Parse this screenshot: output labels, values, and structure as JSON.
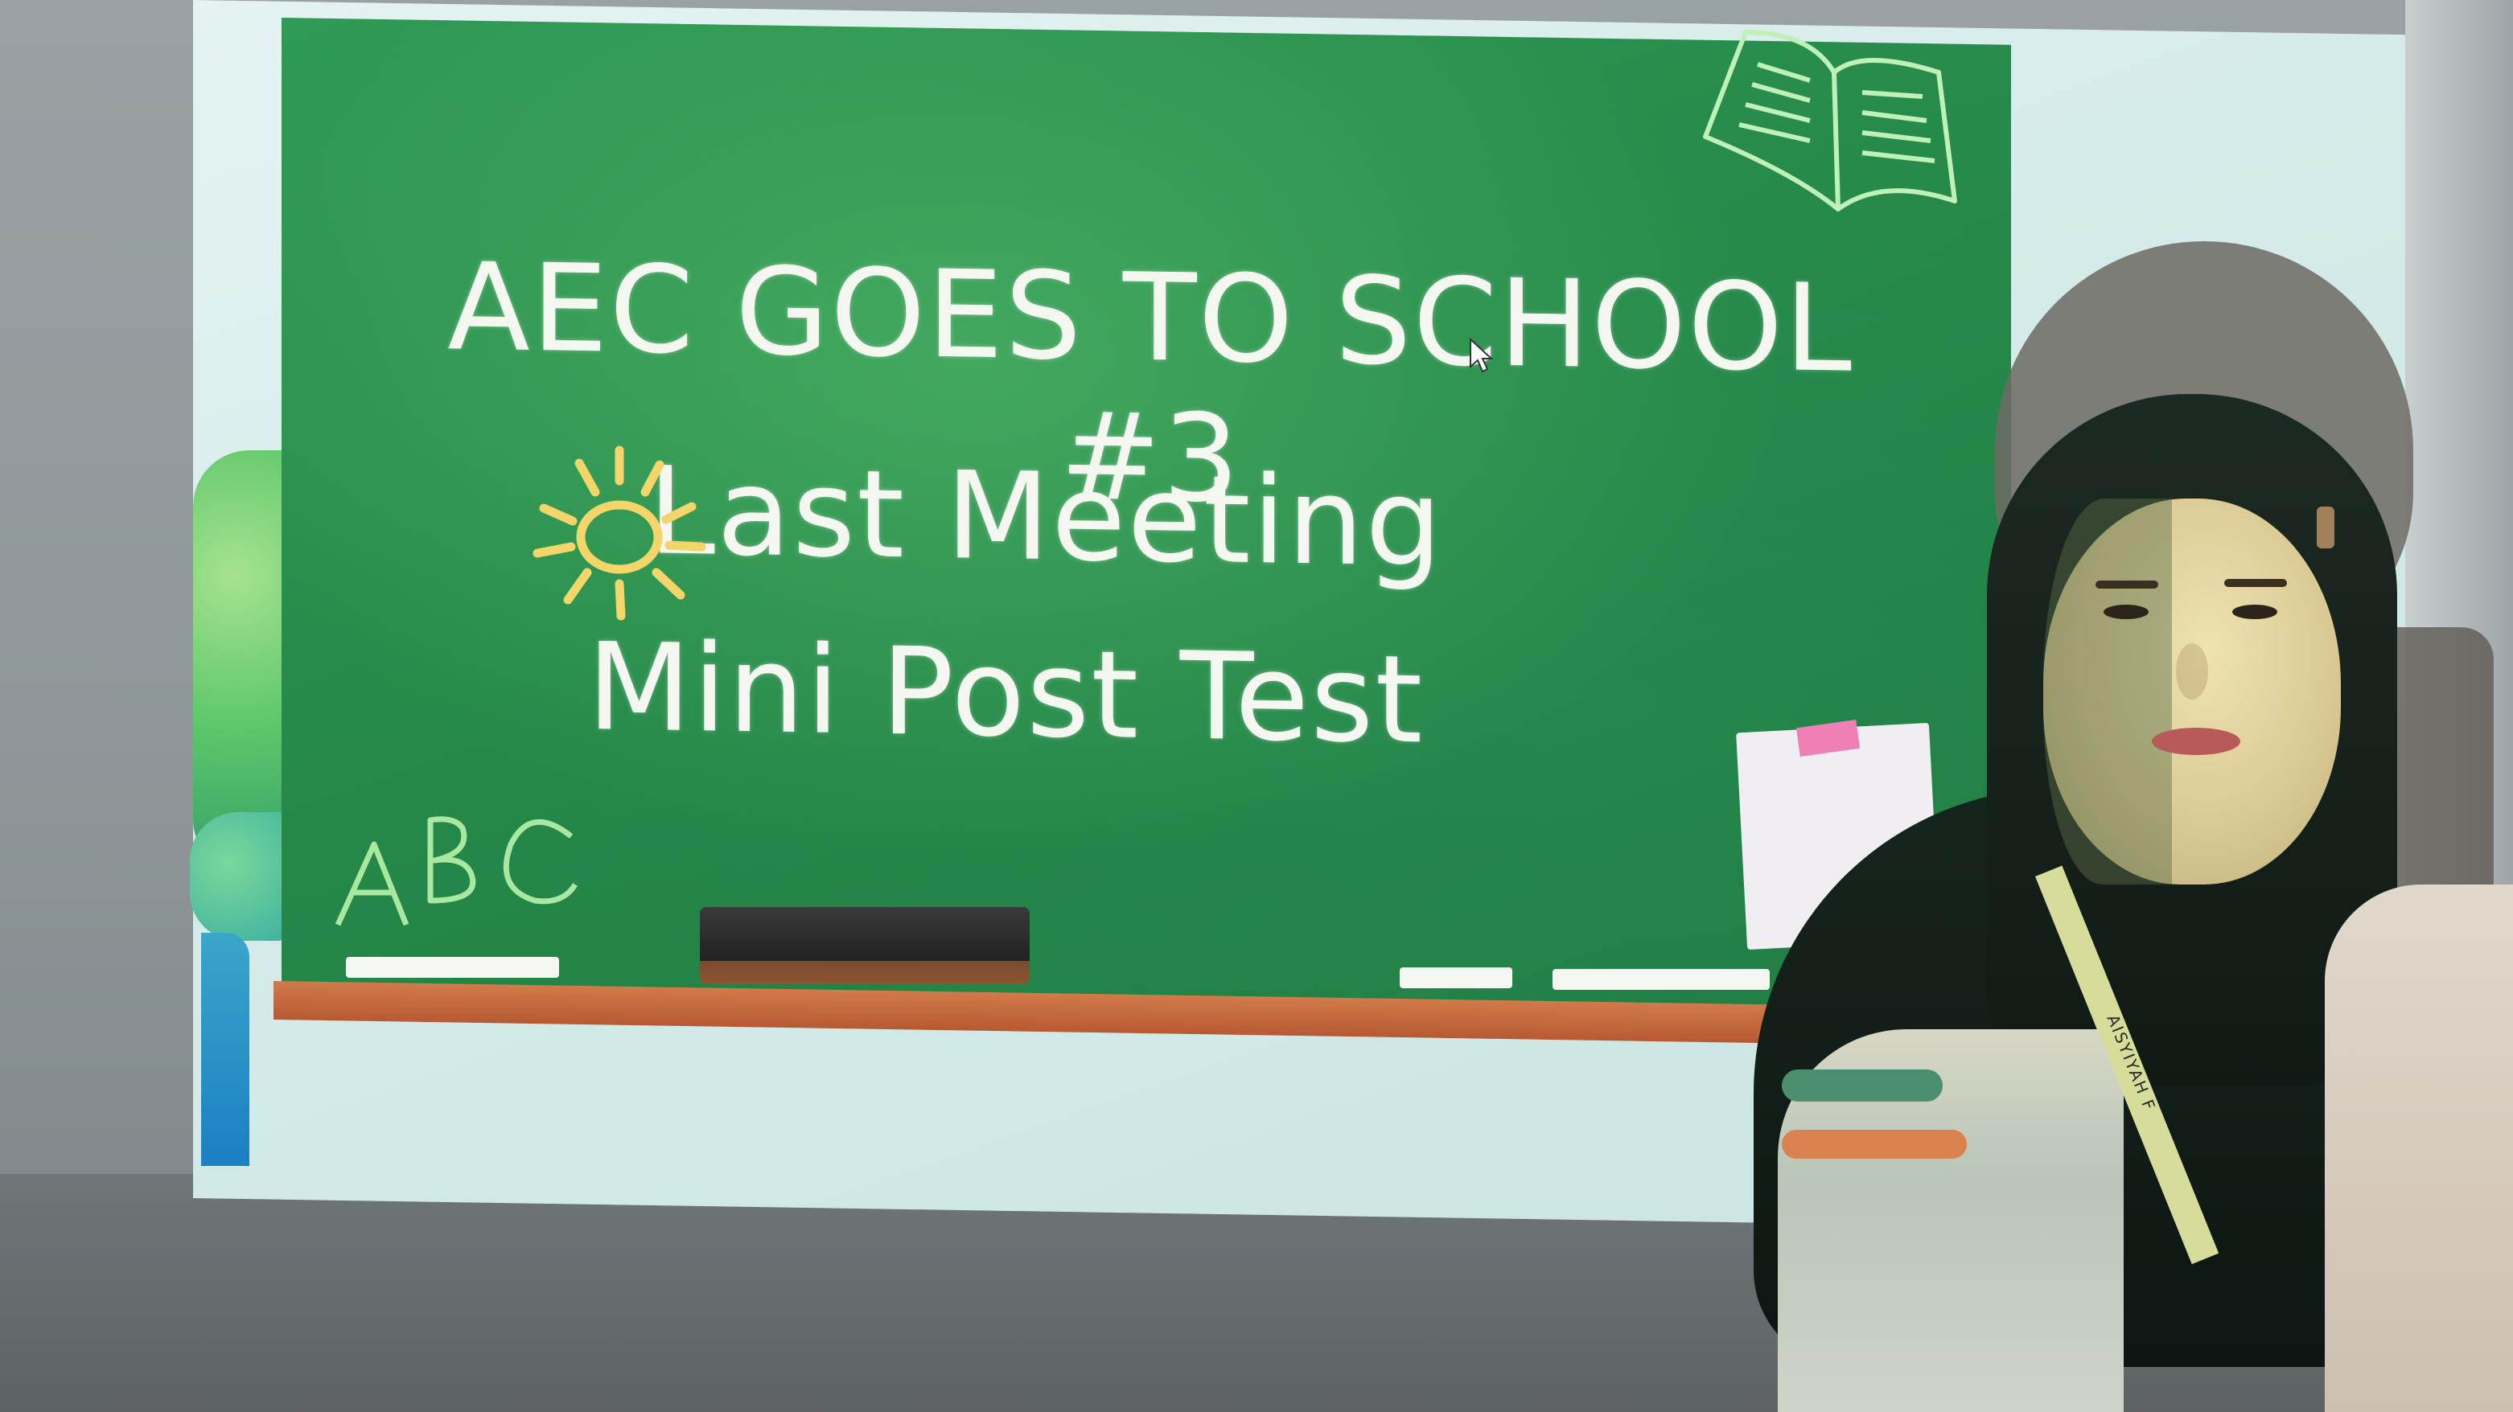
{
  "slide": {
    "title": "AEC GOES TO SCHOOL #3",
    "line1": "Last Meeting",
    "line2": "Mini Post Test",
    "doodle_letters": "ABC"
  },
  "lanyard": {
    "text": "AISYIYAH F"
  },
  "colors": {
    "chalkboard": "#268a4a",
    "chalk_text": "#f3f7ef",
    "sun": "#f3d56a",
    "ledge": "#c66a3e",
    "screen": "#d6ecea",
    "hijab": "#101a15"
  }
}
